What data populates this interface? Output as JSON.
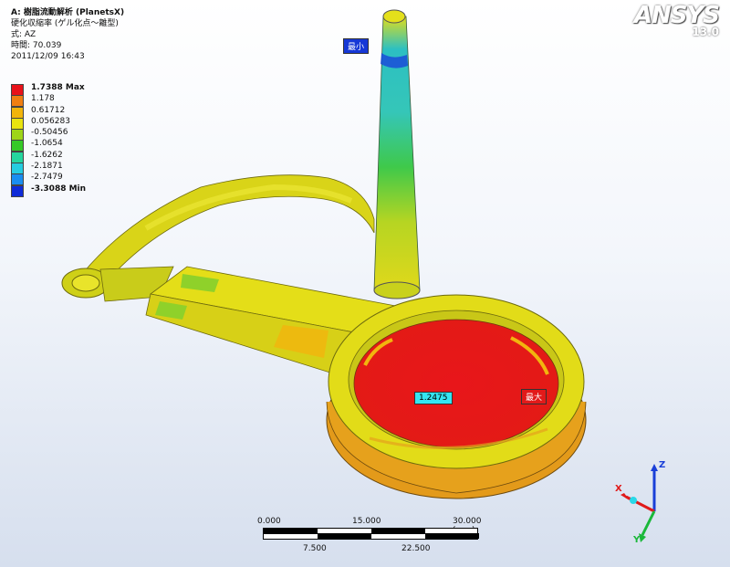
{
  "info": {
    "title": "A: 樹脂流動解析 (PlanetsX)",
    "subtitle": "硬化収縮率 (ゲル化点〜離型)",
    "expression": "式: AZ",
    "time": "時間: 70.039",
    "date": "2011/12/09 16:43"
  },
  "legend": [
    {
      "label": "1.7388 Max",
      "color": "#e8121a",
      "bold": true
    },
    {
      "label": "1.178",
      "color": "#f07f12",
      "bold": false
    },
    {
      "label": "0.61712",
      "color": "#f2b50c",
      "bold": false
    },
    {
      "label": "0.056283",
      "color": "#e9e40f",
      "bold": false
    },
    {
      "label": "-0.50456",
      "color": "#9ed518",
      "bold": false
    },
    {
      "label": "-1.0654",
      "color": "#36c928",
      "bold": false
    },
    {
      "label": "-1.6262",
      "color": "#25d69e",
      "bold": false
    },
    {
      "label": "-2.1871",
      "color": "#26cde0",
      "bold": false
    },
    {
      "label": "-2.7479",
      "color": "#1a8ef0",
      "bold": false
    },
    {
      "label": "-3.3088 Min",
      "color": "#0f2bd8",
      "bold": true
    }
  ],
  "logo": {
    "brand": "ANSYS",
    "version": "13.0"
  },
  "probes": {
    "min": "最小",
    "max": "最大",
    "value": "1.2475"
  },
  "scale": {
    "top": [
      "0.000",
      "15.000",
      "30.000 (mm)"
    ],
    "bottom": [
      "7.500",
      "22.500"
    ]
  },
  "triad": {
    "x": "X",
    "y": "Y",
    "z": "Z"
  }
}
